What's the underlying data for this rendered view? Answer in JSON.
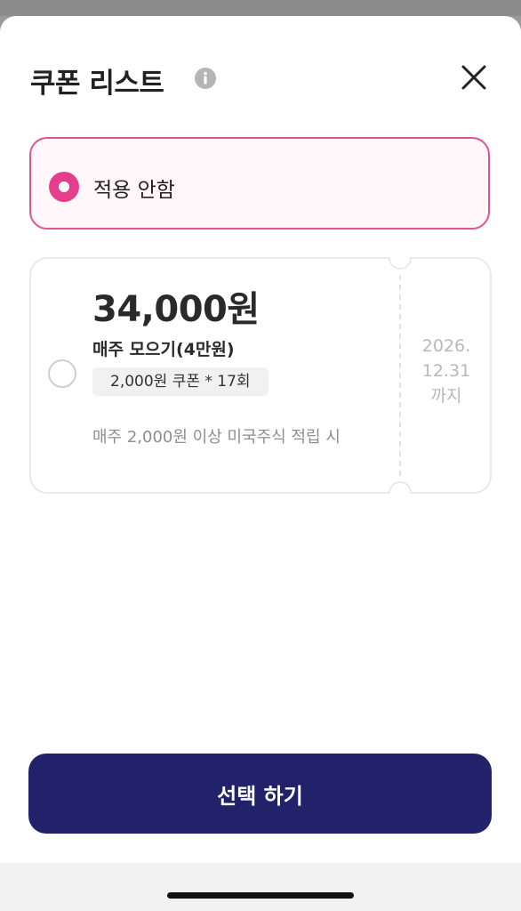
{
  "header": {
    "title": "쿠폰 리스트",
    "info_icon": "info-icon",
    "close_icon": "close-icon"
  },
  "options": {
    "none": {
      "label": "적용 안함",
      "selected": true
    }
  },
  "coupon": {
    "amount": "34,000원",
    "name": "매주 모으기(4만원)",
    "tag": "2,000원 쿠폰 * 17회",
    "condition": "매주 2,000원 이상 미국주식 적립 시",
    "expiry_line1": "2026.",
    "expiry_line2": "12.31",
    "expiry_line3": "까지",
    "selected": false
  },
  "cta": {
    "label": "선택 하기"
  },
  "colors": {
    "accent_pink": "#e63e8c",
    "primary_navy": "#22226a"
  }
}
